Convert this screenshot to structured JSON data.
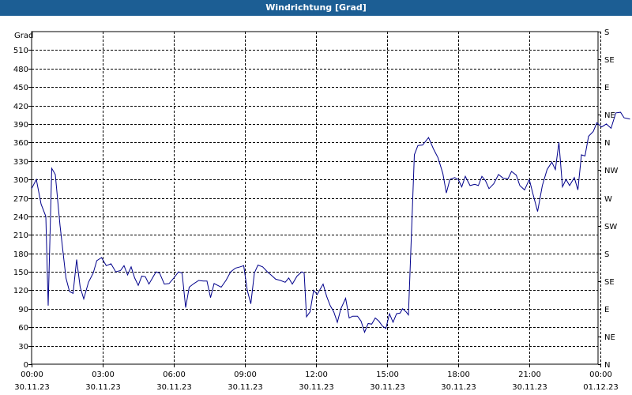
{
  "window": {
    "title": "Windrichtung [Grad]",
    "title_bar_color": "#1c5e94"
  },
  "chart_data": {
    "type": "line",
    "title": "Windrichtung [Grad]",
    "ylabel": "Grad",
    "ylim": [
      0,
      540
    ],
    "yticks": [
      0,
      30,
      60,
      90,
      120,
      150,
      180,
      210,
      240,
      270,
      300,
      330,
      360,
      390,
      420,
      450,
      480,
      510
    ],
    "right_axis_labels": [
      {
        "value": 0,
        "label": "N"
      },
      {
        "value": 45,
        "label": "NE"
      },
      {
        "value": 90,
        "label": "E"
      },
      {
        "value": 135,
        "label": "SE"
      },
      {
        "value": 180,
        "label": "S"
      },
      {
        "value": 225,
        "label": "SW"
      },
      {
        "value": 270,
        "label": "W"
      },
      {
        "value": 315,
        "label": "NW"
      },
      {
        "value": 360,
        "label": "N"
      },
      {
        "value": 405,
        "label": "NE"
      },
      {
        "value": 450,
        "label": "E"
      },
      {
        "value": 495,
        "label": "SE"
      },
      {
        "value": 540,
        "label": "S"
      }
    ],
    "xlim": [
      0,
      24
    ],
    "xticks": [
      {
        "hour": 0,
        "time": "00:00",
        "date": "30.11.23"
      },
      {
        "hour": 3,
        "time": "03:00",
        "date": "30.11.23"
      },
      {
        "hour": 6,
        "time": "06:00",
        "date": "30.11.23"
      },
      {
        "hour": 9,
        "time": "09:00",
        "date": "30.11.23"
      },
      {
        "hour": 12,
        "time": "12:00",
        "date": "30.11.23"
      },
      {
        "hour": 15,
        "time": "15:00",
        "date": "30.11.23"
      },
      {
        "hour": 18,
        "time": "18:00",
        "date": "30.11.23"
      },
      {
        "hour": 21,
        "time": "21:00",
        "date": "30.11.23"
      },
      {
        "hour": 24,
        "time": "00:00",
        "date": "01.12.23"
      }
    ],
    "grid": true,
    "line_color": "#00008b",
    "series": [
      {
        "points": [
          [
            0.0,
            285
          ],
          [
            0.2,
            300
          ],
          [
            0.4,
            260
          ],
          [
            0.6,
            240
          ],
          [
            0.7,
            95
          ],
          [
            0.85,
            318
          ],
          [
            1.0,
            308
          ],
          [
            1.2,
            225
          ],
          [
            1.45,
            140
          ],
          [
            1.6,
            118
          ],
          [
            1.75,
            115
          ],
          [
            1.9,
            170
          ],
          [
            2.05,
            125
          ],
          [
            2.2,
            106
          ],
          [
            2.4,
            133
          ],
          [
            2.6,
            148
          ],
          [
            2.75,
            168
          ],
          [
            2.95,
            173
          ],
          [
            3.15,
            160
          ],
          [
            3.35,
            163
          ],
          [
            3.55,
            150
          ],
          [
            3.75,
            152
          ],
          [
            3.9,
            160
          ],
          [
            4.05,
            145
          ],
          [
            4.2,
            158
          ],
          [
            4.35,
            140
          ],
          [
            4.5,
            128
          ],
          [
            4.65,
            143
          ],
          [
            4.8,
            142
          ],
          [
            4.95,
            130
          ],
          [
            5.1,
            140
          ],
          [
            5.25,
            150
          ],
          [
            5.4,
            148
          ],
          [
            5.6,
            130
          ],
          [
            5.8,
            131
          ],
          [
            6.0,
            140
          ],
          [
            6.2,
            150
          ],
          [
            6.35,
            148
          ],
          [
            6.5,
            92
          ],
          [
            6.65,
            125
          ],
          [
            6.85,
            131
          ],
          [
            7.05,
            136
          ],
          [
            7.25,
            135
          ],
          [
            7.4,
            135
          ],
          [
            7.55,
            108
          ],
          [
            7.7,
            131
          ],
          [
            7.85,
            128
          ],
          [
            8.0,
            125
          ],
          [
            8.2,
            136
          ],
          [
            8.4,
            150
          ],
          [
            8.6,
            156
          ],
          [
            8.8,
            158
          ],
          [
            8.95,
            160
          ],
          [
            9.1,
            120
          ],
          [
            9.25,
            98
          ],
          [
            9.4,
            148
          ],
          [
            9.55,
            161
          ],
          [
            9.75,
            158
          ],
          [
            9.95,
            150
          ],
          [
            10.1,
            145
          ],
          [
            10.3,
            138
          ],
          [
            10.5,
            136
          ],
          [
            10.7,
            133
          ],
          [
            10.85,
            140
          ],
          [
            11.0,
            130
          ],
          [
            11.2,
            143
          ],
          [
            11.4,
            150
          ],
          [
            11.5,
            148
          ],
          [
            11.6,
            77
          ],
          [
            11.75,
            85
          ],
          [
            11.9,
            120
          ],
          [
            12.05,
            113
          ],
          [
            12.15,
            120
          ],
          [
            12.3,
            130
          ],
          [
            12.45,
            110
          ],
          [
            12.6,
            95
          ],
          [
            12.75,
            85
          ],
          [
            12.9,
            68
          ],
          [
            13.05,
            90
          ],
          [
            13.25,
            107
          ],
          [
            13.4,
            75
          ],
          [
            13.55,
            78
          ],
          [
            13.75,
            78
          ],
          [
            13.9,
            70
          ],
          [
            14.05,
            52
          ],
          [
            14.2,
            66
          ],
          [
            14.35,
            65
          ],
          [
            14.5,
            75
          ],
          [
            14.65,
            70
          ],
          [
            14.8,
            62
          ],
          [
            14.95,
            58
          ],
          [
            15.1,
            82
          ],
          [
            15.25,
            68
          ],
          [
            15.4,
            82
          ],
          [
            15.55,
            83
          ],
          [
            15.65,
            90
          ],
          [
            15.8,
            85
          ],
          [
            15.9,
            80
          ],
          [
            16.05,
            235
          ],
          [
            16.15,
            340
          ],
          [
            16.3,
            355
          ],
          [
            16.5,
            356
          ],
          [
            16.75,
            368
          ],
          [
            16.95,
            350
          ],
          [
            17.15,
            335
          ],
          [
            17.35,
            310
          ],
          [
            17.5,
            278
          ],
          [
            17.65,
            300
          ],
          [
            17.85,
            303
          ],
          [
            18.0,
            300
          ],
          [
            18.15,
            288
          ],
          [
            18.3,
            305
          ],
          [
            18.5,
            290
          ],
          [
            18.7,
            292
          ],
          [
            18.85,
            290
          ],
          [
            19.0,
            305
          ],
          [
            19.15,
            298
          ],
          [
            19.3,
            285
          ],
          [
            19.5,
            293
          ],
          [
            19.7,
            308
          ],
          [
            19.9,
            302
          ],
          [
            20.1,
            301
          ],
          [
            20.25,
            313
          ],
          [
            20.45,
            307
          ],
          [
            20.6,
            290
          ],
          [
            20.8,
            283
          ],
          [
            21.0,
            300
          ],
          [
            21.15,
            277
          ],
          [
            21.35,
            248
          ],
          [
            21.55,
            290
          ],
          [
            21.75,
            316
          ],
          [
            21.95,
            328
          ],
          [
            22.1,
            316
          ],
          [
            22.25,
            360
          ],
          [
            22.4,
            288
          ],
          [
            22.55,
            300
          ],
          [
            22.7,
            290
          ],
          [
            22.9,
            303
          ],
          [
            23.05,
            283
          ],
          [
            23.2,
            340
          ],
          [
            23.35,
            338
          ],
          [
            23.5,
            370
          ],
          [
            23.7,
            378
          ],
          [
            23.85,
            392
          ],
          [
            24.05,
            385
          ],
          [
            24.25,
            390
          ],
          [
            24.45,
            383
          ],
          [
            24.65,
            408
          ],
          [
            24.85,
            409
          ],
          [
            25.0,
            400
          ],
          [
            25.25,
            398
          ]
        ]
      }
    ]
  }
}
